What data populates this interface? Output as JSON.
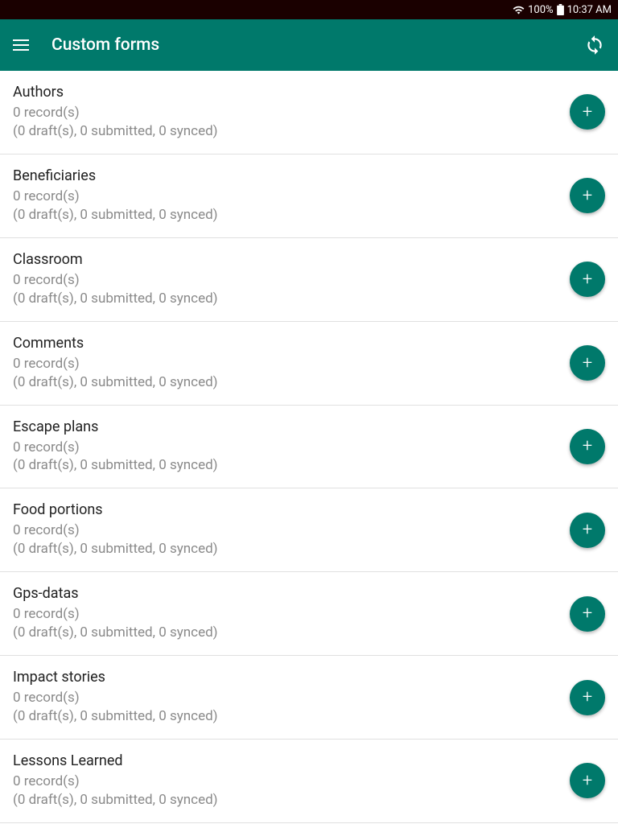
{
  "status": {
    "battery": "100%",
    "time": "10:37 AM"
  },
  "header": {
    "title": "Custom forms"
  },
  "forms": [
    {
      "title": "Authors",
      "records": "0 record(s)",
      "status": "(0 draft(s), 0 submitted, 0 synced)"
    },
    {
      "title": "Beneficiaries",
      "records": "0 record(s)",
      "status": "(0 draft(s), 0 submitted, 0 synced)"
    },
    {
      "title": "Classroom",
      "records": "0 record(s)",
      "status": "(0 draft(s), 0 submitted, 0 synced)"
    },
    {
      "title": "Comments",
      "records": "0 record(s)",
      "status": "(0 draft(s), 0 submitted, 0 synced)"
    },
    {
      "title": "Escape plans",
      "records": "0 record(s)",
      "status": "(0 draft(s), 0 submitted, 0 synced)"
    },
    {
      "title": "Food portions",
      "records": "0 record(s)",
      "status": "(0 draft(s), 0 submitted, 0 synced)"
    },
    {
      "title": "Gps-datas",
      "records": "0 record(s)",
      "status": "(0 draft(s), 0 submitted, 0 synced)"
    },
    {
      "title": "Impact stories",
      "records": "0 record(s)",
      "status": "(0 draft(s), 0 submitted, 0 synced)"
    },
    {
      "title": "Lessons Learned",
      "records": "0 record(s)",
      "status": "(0 draft(s), 0 submitted, 0 synced)"
    }
  ],
  "fab_label": "+"
}
